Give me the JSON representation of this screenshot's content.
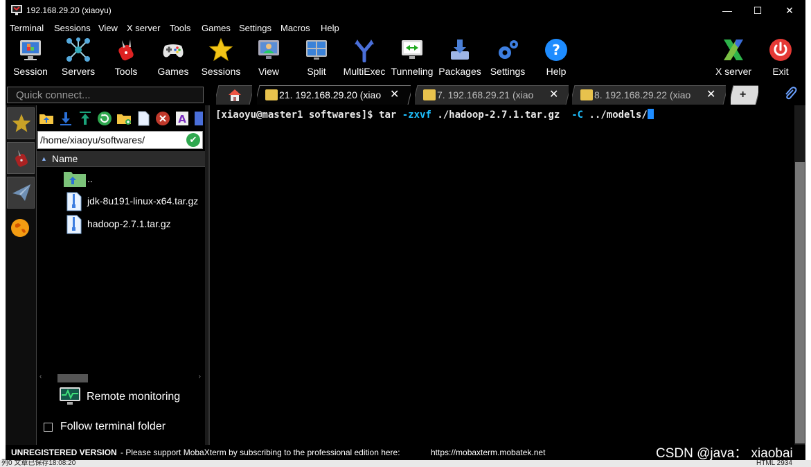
{
  "window": {
    "title": "192.168.29.20 (xiaoyu)",
    "minimize": "—",
    "maximize": "☐",
    "close": "✕"
  },
  "menu": [
    "Terminal",
    "Sessions",
    "View",
    "X server",
    "Tools",
    "Games",
    "Settings",
    "Macros",
    "Help"
  ],
  "toolbar": {
    "session": "Session",
    "servers": "Servers",
    "tools": "Tools",
    "games": "Games",
    "sessions": "Sessions",
    "view": "View",
    "split": "Split",
    "multiexec": "MultiExec",
    "tunneling": "Tunneling",
    "packages": "Packages",
    "settings": "Settings",
    "help": "Help",
    "xserver": "X server",
    "exit": "Exit"
  },
  "quick_connect": {
    "placeholder": "Quick connect..."
  },
  "tabs": [
    {
      "label": "21. 192.168.29.20 (xiao",
      "active": true
    },
    {
      "label": "7. 192.168.29.21 (xiao",
      "active": false
    },
    {
      "label": "8. 192.168.29.22 (xiao",
      "active": false
    }
  ],
  "sftp": {
    "path": "/home/xiaoyu/softwares/",
    "column_name": "Name",
    "files": [
      "..",
      "jdk-8u191-linux-x64.tar.gz",
      "hadoop-2.7.1.tar.gz"
    ],
    "remote_monitoring": "Remote monitoring",
    "follow_folder": "Follow terminal folder"
  },
  "terminal": {
    "prompt": "[xiaoyu@master1 softwares]$ ",
    "cmd1": "tar ",
    "opt1": "-zxvf",
    "cmd2": " ./hadoop-2.7.1.tar.gz  ",
    "opt2": "-C",
    "cmd3": " ../models/"
  },
  "status": {
    "unregistered": "UNREGISTERED VERSION",
    "message": " -  Please support MobaXterm by subscribing to the professional edition here:",
    "link": "https://mobaxterm.mobatek.net"
  },
  "watermark": "CSDN @java： xiaobai",
  "background_app": {
    "left_text": "列0  文章已保存18:08:20",
    "right_text": "HTML   2934"
  },
  "colors": {
    "accent_blue": "#1e8cff",
    "option_cyan": "#1ec0ff",
    "tab_icon": "#e8c24d"
  }
}
